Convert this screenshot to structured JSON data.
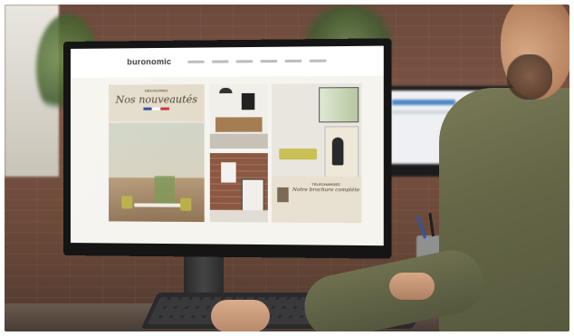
{
  "scene": {
    "monitor_site": {
      "logo": "buronomic",
      "hero_tile": {
        "kicker": "DÉCOUVREZ",
        "title": "Nos nouveautés"
      },
      "brochure_tile": {
        "kicker": "TÉLÉCHARGEZ",
        "title": "Notre brochure complète"
      }
    }
  }
}
